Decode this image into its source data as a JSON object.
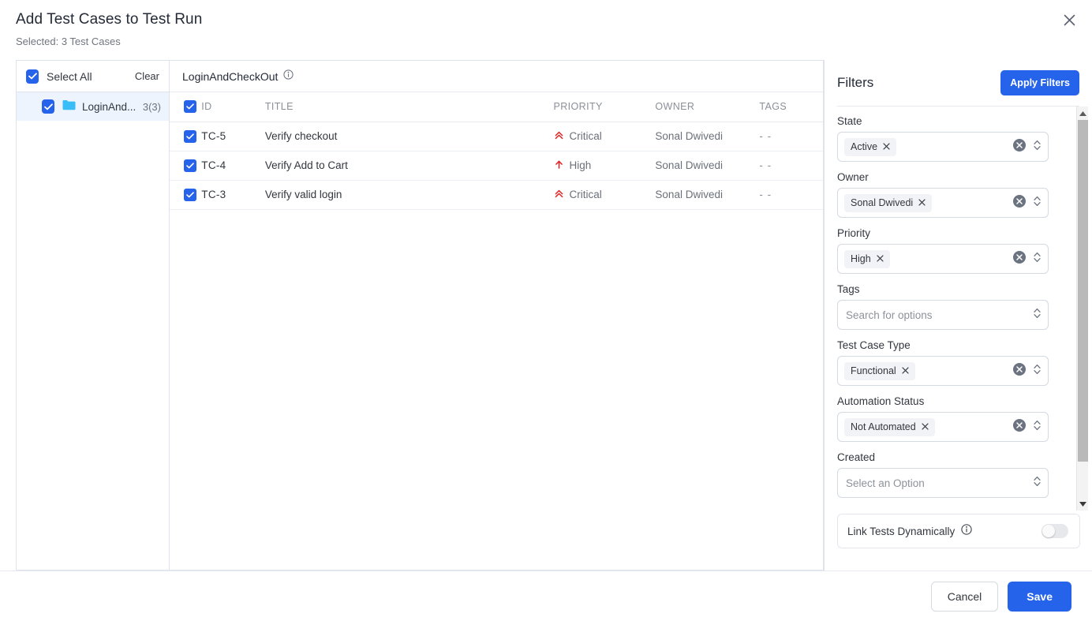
{
  "header": {
    "title": "Add Test Cases to Test Run",
    "subtitle": "Selected: 3 Test Cases",
    "close_icon": "close-icon"
  },
  "tree": {
    "select_all_label": "Select All",
    "clear_label": "Clear",
    "select_all_checked": true,
    "nodes": [
      {
        "label": "LoginAnd...",
        "count": "3(3)",
        "checked": true,
        "icon": "folder-icon",
        "selected": true
      }
    ]
  },
  "table": {
    "suite_title": "LoginAndCheckOut",
    "suite_info_icon": "info-icon",
    "header_checkbox_checked": true,
    "columns": [
      "ID",
      "TITLE",
      "PRIORITY",
      "OWNER",
      "TAGS"
    ],
    "rows": [
      {
        "checked": true,
        "id": "TC-5",
        "title": "Verify checkout",
        "priority": "Critical",
        "priority_icon": "double-chevron-up-icon",
        "owner": "Sonal Dwivedi",
        "tags": "- -"
      },
      {
        "checked": true,
        "id": "TC-4",
        "title": "Verify Add to Cart",
        "priority": "High",
        "priority_icon": "arrow-up-icon",
        "owner": "Sonal Dwivedi",
        "tags": "- -"
      },
      {
        "checked": true,
        "id": "TC-3",
        "title": "Verify valid login",
        "priority": "Critical",
        "priority_icon": "double-chevron-up-icon",
        "owner": "Sonal Dwivedi",
        "tags": "- -"
      }
    ]
  },
  "filters": {
    "title": "Filters",
    "apply_label": "Apply Filters",
    "groups": [
      {
        "label": "State",
        "chip": "Active",
        "placeholder": null,
        "has_clear": true
      },
      {
        "label": "Owner",
        "chip": "Sonal Dwivedi",
        "placeholder": null,
        "has_clear": true
      },
      {
        "label": "Priority",
        "chip": "High",
        "placeholder": null,
        "has_clear": true
      },
      {
        "label": "Tags",
        "chip": null,
        "placeholder": "Search for options",
        "has_clear": false
      },
      {
        "label": "Test Case Type",
        "chip": "Functional",
        "placeholder": null,
        "has_clear": true
      },
      {
        "label": "Automation Status",
        "chip": "Not Automated",
        "placeholder": null,
        "has_clear": true
      },
      {
        "label": "Created",
        "chip": null,
        "placeholder": "Select an Option",
        "has_clear": false
      }
    ],
    "link_tests": {
      "label": "Link Tests Dynamically",
      "info_icon": "info-icon",
      "enabled": false
    }
  },
  "footer": {
    "cancel_label": "Cancel",
    "save_label": "Save"
  },
  "colors": {
    "accent": "#2563eb",
    "critical": "#e02020",
    "high": "#e02020",
    "folder": "#38bdf8",
    "selected_row_bg": "#eef4fd"
  }
}
